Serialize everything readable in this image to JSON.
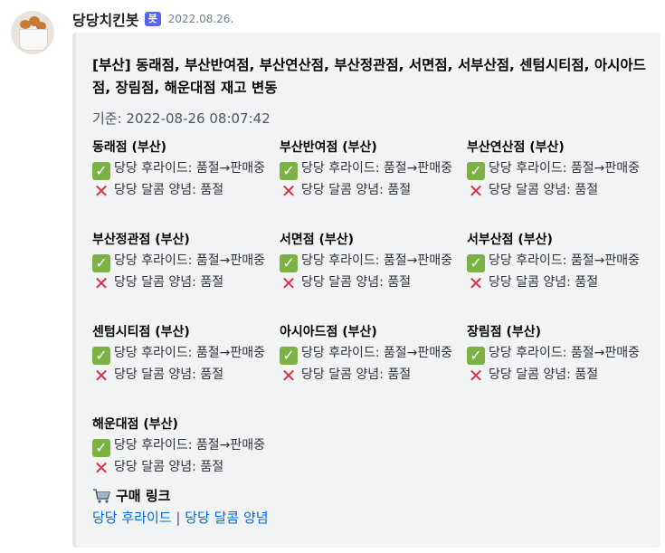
{
  "message": {
    "bot_name": "당당치킨봇",
    "bot_tag": "봇",
    "timestamp": "2022.08.26."
  },
  "embed": {
    "title": "[부산] 동래점, 부산반여점, 부산연산점, 부산정관점, 서면점, 서부산점, 센텀시티점, 아시아드점, 장림점, 해운대점 재고 변동",
    "description": "기준: 2022-08-26 08:07:42",
    "stores": [
      {
        "name": "동래점 (부산)",
        "item1": "당당 후라이드: 품절→판매중",
        "item2": "당당 달콤 양념: 품절"
      },
      {
        "name": "부산반여점 (부산)",
        "item1": "당당 후라이드: 품절→판매중",
        "item2": "당당 달콤 양념: 품절"
      },
      {
        "name": "부산연산점 (부산)",
        "item1": "당당 후라이드: 품절→판매중",
        "item2": "당당 달콤 양념: 품절"
      },
      {
        "name": "부산정관점 (부산)",
        "item1": "당당 후라이드: 품절→판매중",
        "item2": "당당 달콤 양념: 품절"
      },
      {
        "name": "서면점 (부산)",
        "item1": "당당 후라이드: 품절→판매중",
        "item2": "당당 달콤 양념: 품절"
      },
      {
        "name": "서부산점 (부산)",
        "item1": "당당 후라이드: 품절→판매중",
        "item2": "당당 달콤 양념: 품절"
      },
      {
        "name": "센텀시티점 (부산)",
        "item1": "당당 후라이드: 품절→판매중",
        "item2": "당당 달콤 양념: 품절"
      },
      {
        "name": "아시아드점 (부산)",
        "item1": "당당 후라이드: 품절→판매중",
        "item2": "당당 달콤 양념: 품절"
      },
      {
        "name": "장림점 (부산)",
        "item1": "당당 후라이드: 품절→판매중",
        "item2": "당당 달콤 양념: 품절"
      },
      {
        "name": "해운대점 (부산)",
        "item1": "당당 후라이드: 품절→판매중",
        "item2": "당당 달콤 양념: 품절"
      }
    ],
    "purchase": {
      "title": "구매 링크",
      "link1": "당당 후라이드",
      "separator": "|",
      "link2": "당당 달콤 양념"
    }
  },
  "icons": {
    "available": "check-mark-button-icon",
    "soldout": "cross-mark-icon",
    "cart": "shopping-cart-icon"
  },
  "colors": {
    "bot_tag": "#5865f2",
    "link": "#0068e0",
    "check": "#7bb243",
    "cross": "#dd2e44"
  }
}
